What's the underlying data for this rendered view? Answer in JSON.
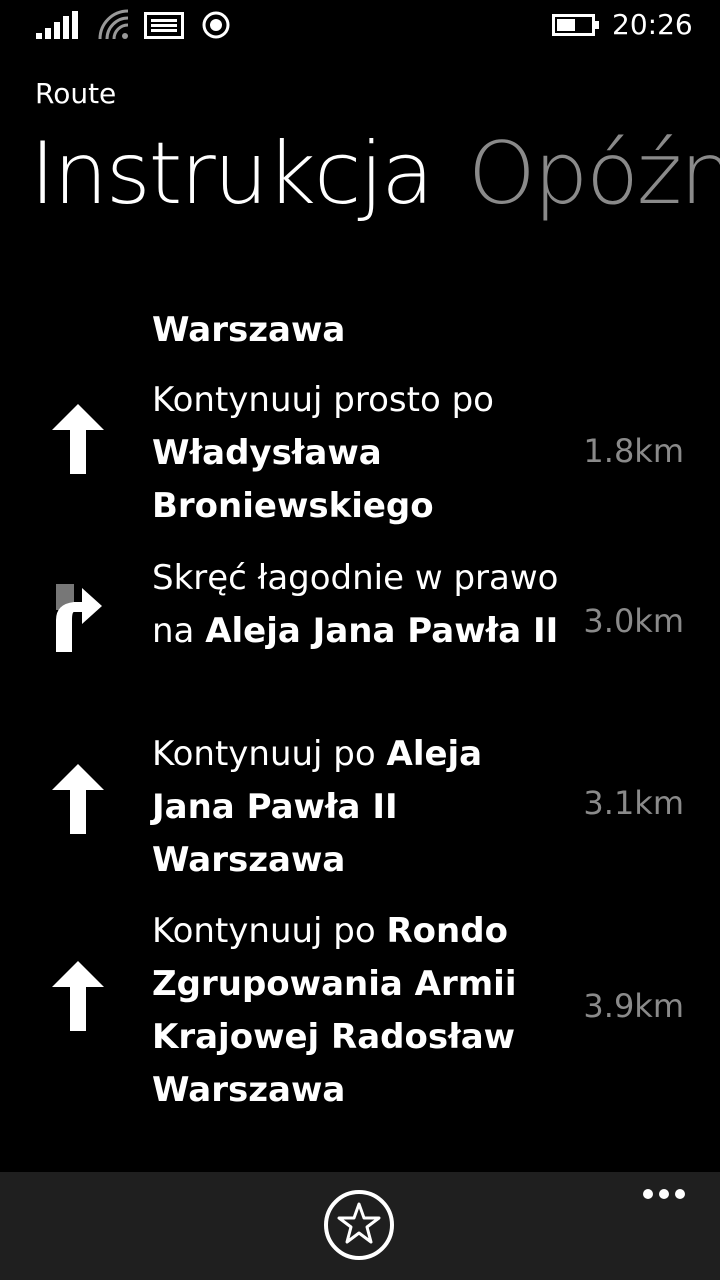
{
  "status": {
    "time": "20:26",
    "icons": [
      "signal-icon",
      "wifi-icon",
      "message-icon",
      "location-icon",
      "battery-icon"
    ]
  },
  "app": {
    "title": "Route"
  },
  "pivot": {
    "tabs": [
      {
        "label": "Instrukcja",
        "active": true
      },
      {
        "label": "Opóźn",
        "active": false
      }
    ]
  },
  "steps": [
    {
      "icon": "none",
      "prefix": "",
      "bold": "Warszawa",
      "distance": ""
    },
    {
      "icon": "straight-arrow-icon",
      "prefix": "Kontynuuj prosto po ",
      "bold": "Władysława Broniewskiego",
      "distance": "1.8km"
    },
    {
      "icon": "bear-right-arrow-icon",
      "prefix": "Skręć łagodnie w prawo na ",
      "bold": "Aleja Jana Pawła II",
      "distance": "3.0km"
    },
    {
      "icon": "straight-arrow-icon",
      "prefix": "Kontynuuj po ",
      "bold": "Aleja Jana Pawła II Warszawa",
      "distance": "3.1km"
    },
    {
      "icon": "straight-arrow-icon",
      "prefix": "Kontynuuj po ",
      "bold": "Rondo Zgrupowania Armii Krajowej Radosław Warszawa",
      "distance": "3.9km"
    }
  ],
  "appbar": {
    "favorite_icon": "star-icon",
    "more_icon": "ellipsis-icon"
  }
}
